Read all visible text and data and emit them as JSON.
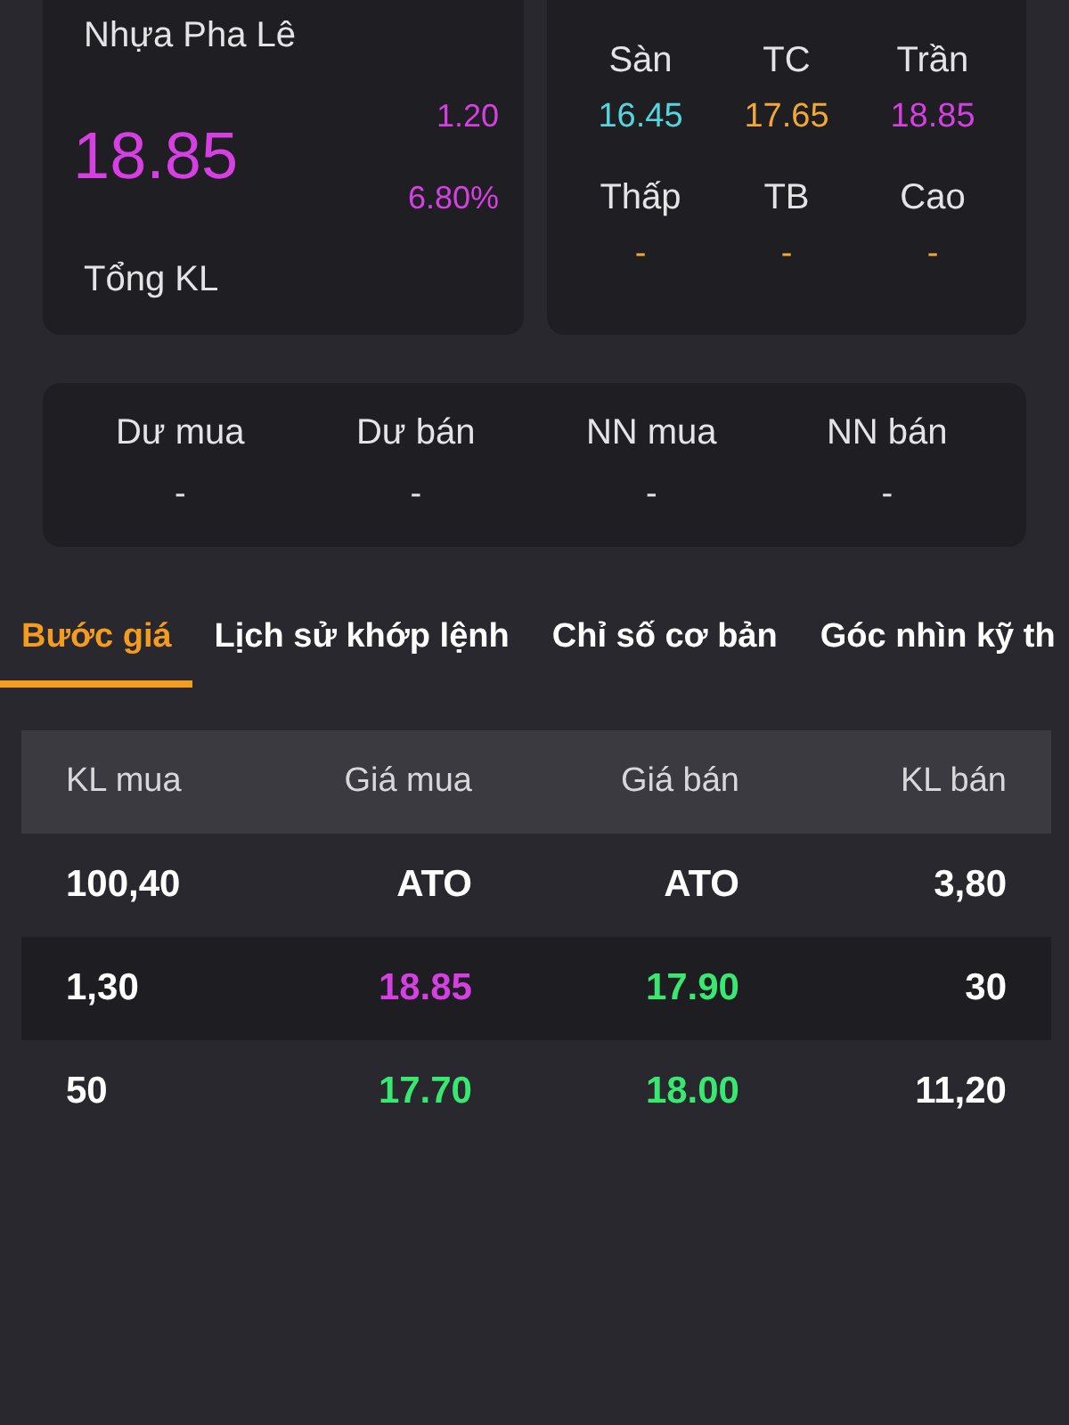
{
  "quote": {
    "name": "Nhựa Pha Lê",
    "price": {
      "text": "18.85",
      "color": "#d63fe2"
    },
    "change": {
      "text": "1.20",
      "color": "#d63fe2"
    },
    "change_percent": {
      "text": "6.80%",
      "color": "#d63fe2"
    },
    "total_volume_label": "Tổng KL"
  },
  "price_levels": [
    {
      "label": "Sàn",
      "value": "16.45",
      "color": "#55d6df"
    },
    {
      "label": "TC",
      "value": "17.65",
      "color": "#f2a834"
    },
    {
      "label": "Trần",
      "value": "18.85",
      "color": "#d63fe2"
    },
    {
      "label": "Thấp",
      "value": "-",
      "color": "#f2a834"
    },
    {
      "label": "TB",
      "value": "-",
      "color": "#f2a834"
    },
    {
      "label": "Cao",
      "value": "-",
      "color": "#f2a834"
    }
  ],
  "flows": [
    {
      "label": "Dư mua",
      "value": "-"
    },
    {
      "label": "Dư bán",
      "value": "-"
    },
    {
      "label": "NN mua",
      "value": "-"
    },
    {
      "label": "NN bán",
      "value": "-"
    }
  ],
  "tabs": [
    {
      "label": "Bước giá",
      "selected": true
    },
    {
      "label": "Lịch sử khớp lệnh",
      "selected": false
    },
    {
      "label": "Chỉ số cơ bản",
      "selected": false
    },
    {
      "label": "Góc nhìn kỹ th",
      "selected": false
    }
  ],
  "order_book": {
    "columns": [
      "KL mua",
      "Giá mua",
      "Giá bán",
      "KL bán"
    ],
    "rows": [
      {
        "buy_volume": "100,40",
        "buy_price": {
          "text": "ATO",
          "color": "#ffffff"
        },
        "sell_price": {
          "text": "ATO",
          "color": "#ffffff"
        },
        "sell_volume": "3,80"
      },
      {
        "buy_volume": "1,30",
        "buy_price": {
          "text": "18.85",
          "color": "#d63fe2"
        },
        "sell_price": {
          "text": "17.90",
          "color": "#38e870"
        },
        "sell_volume": "30"
      },
      {
        "buy_volume": "50",
        "buy_price": {
          "text": "17.70",
          "color": "#38e870"
        },
        "sell_price": {
          "text": "18.00",
          "color": "#38e870"
        },
        "sell_volume": "11,20"
      }
    ]
  }
}
